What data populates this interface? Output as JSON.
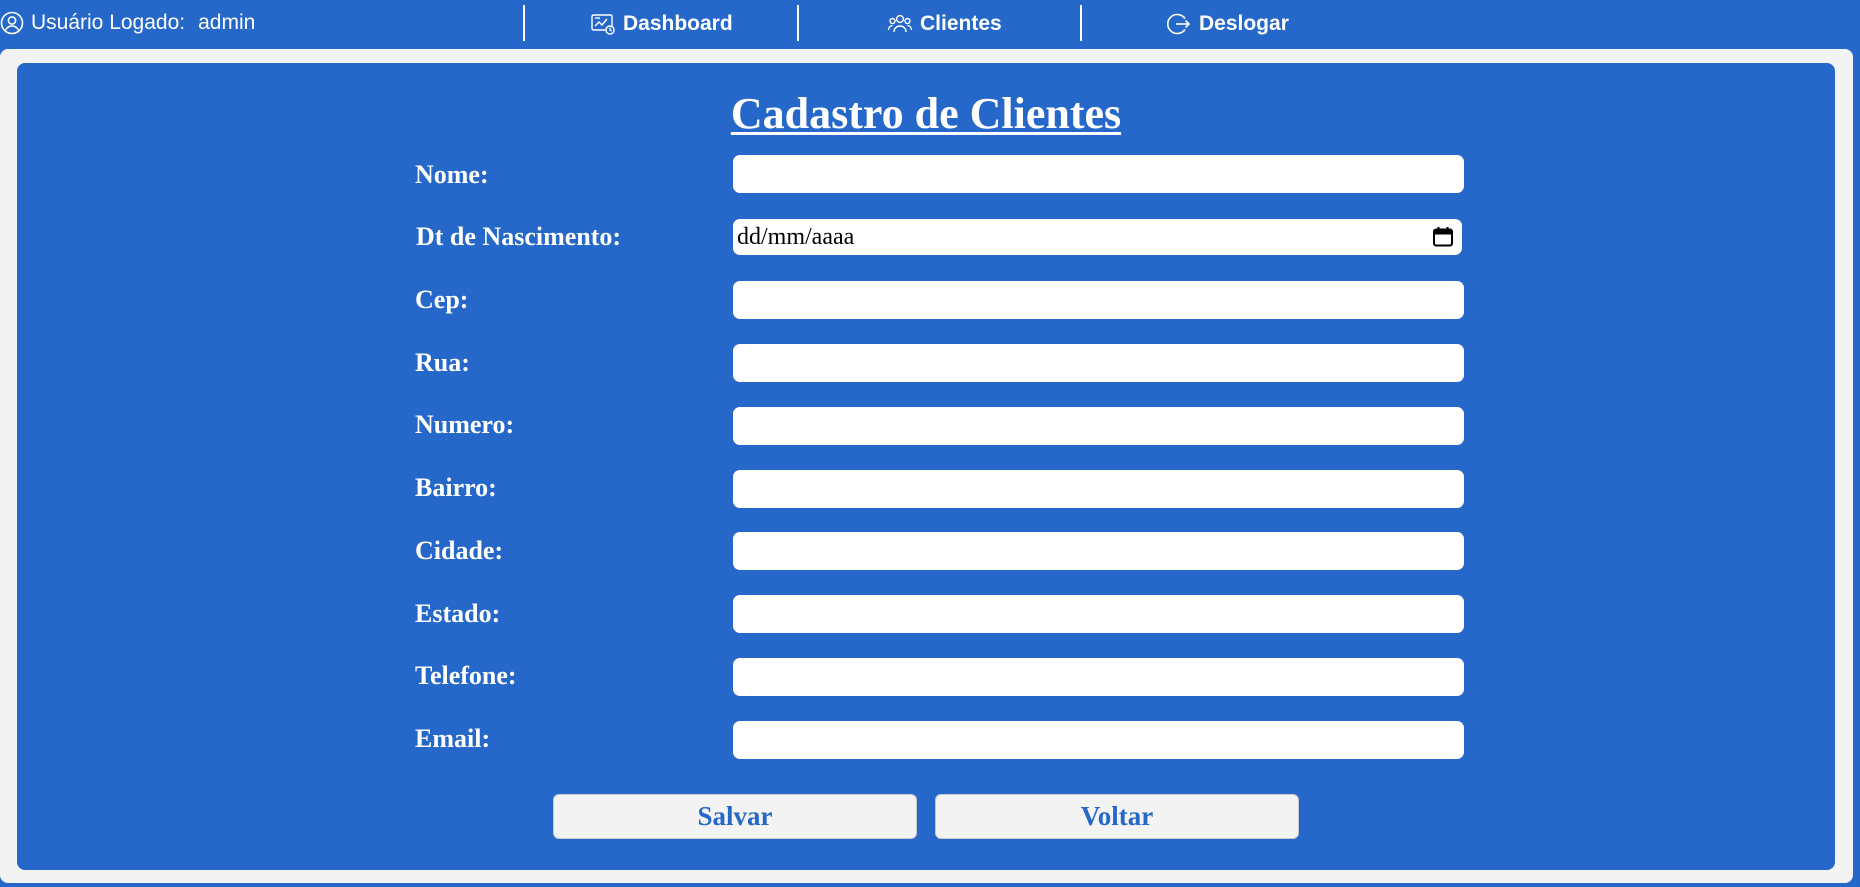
{
  "header": {
    "user_label": "Usuário Logado:",
    "username": "admin",
    "nav": [
      {
        "label": "Dashboard",
        "icon": "dashboard-icon"
      },
      {
        "label": "Clientes",
        "icon": "users-icon"
      },
      {
        "label": "Deslogar",
        "icon": "logout-icon"
      }
    ]
  },
  "form": {
    "title": "Cadastro de Clientes",
    "fields": [
      {
        "label": "Nome:",
        "value": ""
      },
      {
        "label": "Dt de Nascimento:",
        "value": "dd/mm/aaaa"
      },
      {
        "label": "Cep:",
        "value": ""
      },
      {
        "label": "Rua:",
        "value": ""
      },
      {
        "label": "Numero:",
        "value": ""
      },
      {
        "label": "Bairro:",
        "value": ""
      },
      {
        "label": "Cidade:",
        "value": ""
      },
      {
        "label": "Estado:",
        "value": ""
      },
      {
        "label": "Telefone:",
        "value": ""
      },
      {
        "label": "Email:",
        "value": ""
      }
    ],
    "save_label": "Salvar",
    "back_label": "Voltar"
  },
  "colors": {
    "primary": "#2568c9",
    "frame": "#f4f3f3",
    "input_bg": "#ffffff",
    "text_light": "#ffffff"
  }
}
